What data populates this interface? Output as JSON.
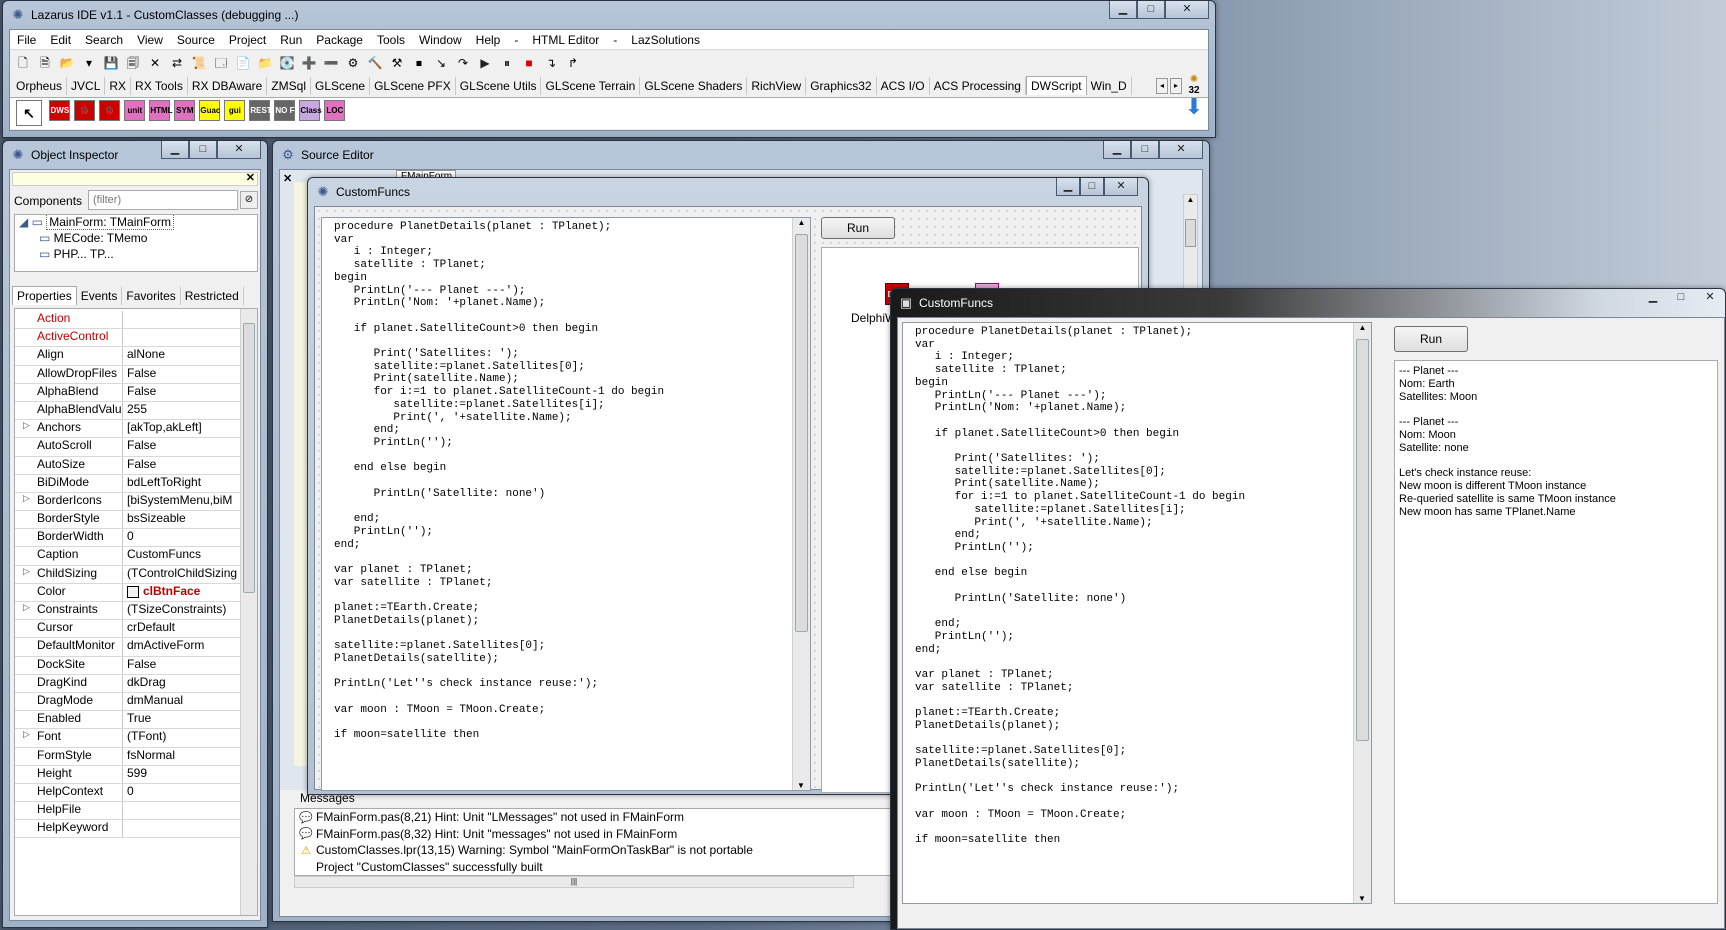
{
  "main": {
    "title": "Lazarus IDE v1.1 - CustomClasses (debugging ...)",
    "menu": [
      "File",
      "Edit",
      "Search",
      "View",
      "Source",
      "Project",
      "Run",
      "Package",
      "Tools",
      "Window",
      "Help",
      "-",
      "HTML Editor",
      "-",
      "LazSolutions"
    ],
    "palette_tabs": [
      "Orpheus",
      "JVCL",
      "RX",
      "RX Tools",
      "RX DBAware",
      "ZMSql",
      "GLScene",
      "GLScene PFX",
      "GLScene Utils",
      "GLScene Terrain",
      "GLScene Shaders",
      "RichView",
      "Graphics32",
      "ACS I/O",
      "ACS Processing",
      "DWScript",
      "Win_D"
    ],
    "active_tab": "DWScript",
    "palette_buttons": [
      "DWS",
      "",
      "",
      "unit",
      "HTML",
      "SYM",
      "Guac",
      "gui",
      "RESTR FS",
      "NO FS",
      "Class",
      "LOC"
    ],
    "bitness": "32"
  },
  "inspector": {
    "title": "Object Inspector",
    "components_label": "Components",
    "filter_placeholder": "(filter)",
    "tree": [
      "MainForm: TMainForm",
      "MECode: TMemo",
      "PHP... TP..."
    ],
    "tabs": [
      "Properties",
      "Events",
      "Favorites",
      "Restricted"
    ],
    "properties": [
      {
        "name": "Action",
        "value": "",
        "red": true
      },
      {
        "name": "ActiveControl",
        "value": "",
        "red": true
      },
      {
        "name": "Align",
        "value": "alNone"
      },
      {
        "name": "AllowDropFiles",
        "value": "False"
      },
      {
        "name": "AlphaBlend",
        "value": "False"
      },
      {
        "name": "AlphaBlendValue",
        "value": "255"
      },
      {
        "name": "Anchors",
        "value": "[akTop,akLeft]",
        "expand": true
      },
      {
        "name": "AutoScroll",
        "value": "False"
      },
      {
        "name": "AutoSize",
        "value": "False"
      },
      {
        "name": "BiDiMode",
        "value": "bdLeftToRight"
      },
      {
        "name": "BorderIcons",
        "value": "[biSystemMenu,biM",
        "expand": true
      },
      {
        "name": "BorderStyle",
        "value": "bsSizeable"
      },
      {
        "name": "BorderWidth",
        "value": "0"
      },
      {
        "name": "Caption",
        "value": "CustomFuncs"
      },
      {
        "name": "ChildSizing",
        "value": "(TControlChildSizing",
        "expand": true
      },
      {
        "name": "Color",
        "value": "clBtnFace",
        "color": true
      },
      {
        "name": "Constraints",
        "value": "(TSizeConstraints)",
        "expand": true
      },
      {
        "name": "Cursor",
        "value": "crDefault"
      },
      {
        "name": "DefaultMonitor",
        "value": "dmActiveForm"
      },
      {
        "name": "DockSite",
        "value": "False"
      },
      {
        "name": "DragKind",
        "value": "dkDrag"
      },
      {
        "name": "DragMode",
        "value": "dmManual"
      },
      {
        "name": "Enabled",
        "value": "True"
      },
      {
        "name": "Font",
        "value": "(TFont)",
        "expand": true
      },
      {
        "name": "FormStyle",
        "value": "fsNormal"
      },
      {
        "name": "Height",
        "value": "599"
      },
      {
        "name": "HelpContext",
        "value": "0"
      },
      {
        "name": "HelpFile",
        "value": ""
      },
      {
        "name": "HelpKeyword",
        "value": ""
      }
    ]
  },
  "source_editor": {
    "title": "Source Editor",
    "tab_partial": "FMainForm",
    "messages_title": "Messages",
    "messages": [
      {
        "icon": "hint",
        "text": "FMainForm.pas(8,21) Hint: Unit \"LMessages\" not used in FMainForm"
      },
      {
        "icon": "hint",
        "text": "FMainForm.pas(8,32) Hint: Unit \"messages\" not used in FMainForm"
      },
      {
        "icon": "warning",
        "text": "CustomClasses.lpr(13,15) Warning: Symbol \"MainFormOnTaskBar\" is not portable"
      },
      {
        "icon": "none",
        "text": "Project \"CustomClasses\" successfully built"
      }
    ]
  },
  "design_form": {
    "title": "CustomFuncs",
    "run_label": "Run",
    "component_label": "DelphiW",
    "code": "procedure PlanetDetails(planet : TPlanet);\nvar\n   i : Integer;\n   satellite : TPlanet;\nbegin\n   PrintLn('--- Planet ---');\n   PrintLn('Nom: '+planet.Name);\n\n   if planet.SatelliteCount>0 then begin\n\n      Print('Satellites: ');\n      satellite:=planet.Satellites[0];\n      Print(satellite.Name);\n      for i:=1 to planet.SatelliteCount-1 do begin\n         satellite:=planet.Satellites[i];\n         Print(', '+satellite.Name);\n      end;\n      PrintLn('');\n\n   end else begin\n\n      PrintLn('Satellite: none')\n\n   end;\n   PrintLn('');\nend;\n\nvar planet : TPlanet;\nvar satellite : TPlanet;\n\nplanet:=TEarth.Create;\nPlanetDetails(planet);\n\nsatellite:=planet.Satellites[0];\nPlanetDetails(satellite);\n\nPrintLn('Let''s check instance reuse:');\n\nvar moon : TMoon = TMoon.Create;\n\nif moon=satellite then"
  },
  "runtime_form": {
    "title": "CustomFuncs",
    "run_label": "Run",
    "output": "--- Planet ---\nNom: Earth\nSatellites: Moon\n\n--- Planet ---\nNom: Moon\nSatellite: none\n\nLet's check instance reuse:\nNew moon is different TMoon instance\nRe-queried satellite is same TMoon instance\nNew moon has same TPlanet.Name"
  }
}
